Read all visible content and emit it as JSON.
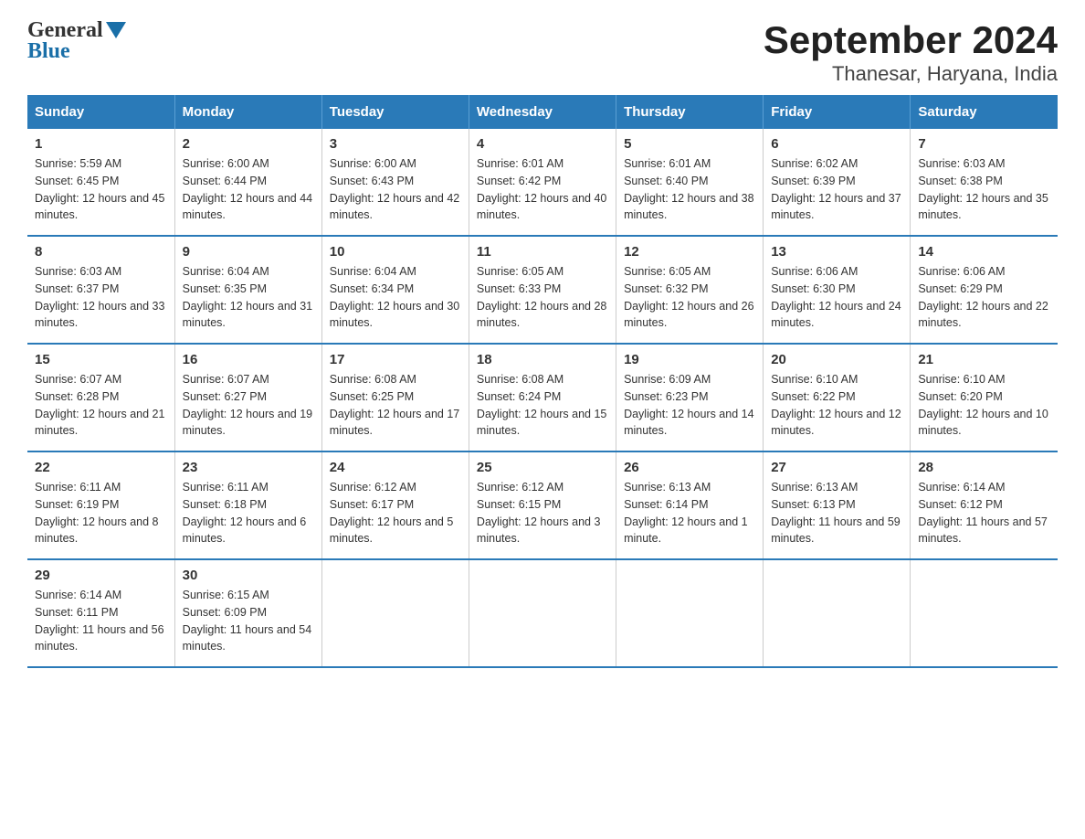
{
  "header": {
    "title": "September 2024",
    "subtitle": "Thanesar, Haryana, India",
    "logo_general": "General",
    "logo_blue": "Blue"
  },
  "columns": [
    "Sunday",
    "Monday",
    "Tuesday",
    "Wednesday",
    "Thursday",
    "Friday",
    "Saturday"
  ],
  "weeks": [
    [
      {
        "num": "1",
        "sunrise": "5:59 AM",
        "sunset": "6:45 PM",
        "daylight": "12 hours and 45 minutes."
      },
      {
        "num": "2",
        "sunrise": "6:00 AM",
        "sunset": "6:44 PM",
        "daylight": "12 hours and 44 minutes."
      },
      {
        "num": "3",
        "sunrise": "6:00 AM",
        "sunset": "6:43 PM",
        "daylight": "12 hours and 42 minutes."
      },
      {
        "num": "4",
        "sunrise": "6:01 AM",
        "sunset": "6:42 PM",
        "daylight": "12 hours and 40 minutes."
      },
      {
        "num": "5",
        "sunrise": "6:01 AM",
        "sunset": "6:40 PM",
        "daylight": "12 hours and 38 minutes."
      },
      {
        "num": "6",
        "sunrise": "6:02 AM",
        "sunset": "6:39 PM",
        "daylight": "12 hours and 37 minutes."
      },
      {
        "num": "7",
        "sunrise": "6:03 AM",
        "sunset": "6:38 PM",
        "daylight": "12 hours and 35 minutes."
      }
    ],
    [
      {
        "num": "8",
        "sunrise": "6:03 AM",
        "sunset": "6:37 PM",
        "daylight": "12 hours and 33 minutes."
      },
      {
        "num": "9",
        "sunrise": "6:04 AM",
        "sunset": "6:35 PM",
        "daylight": "12 hours and 31 minutes."
      },
      {
        "num": "10",
        "sunrise": "6:04 AM",
        "sunset": "6:34 PM",
        "daylight": "12 hours and 30 minutes."
      },
      {
        "num": "11",
        "sunrise": "6:05 AM",
        "sunset": "6:33 PM",
        "daylight": "12 hours and 28 minutes."
      },
      {
        "num": "12",
        "sunrise": "6:05 AM",
        "sunset": "6:32 PM",
        "daylight": "12 hours and 26 minutes."
      },
      {
        "num": "13",
        "sunrise": "6:06 AM",
        "sunset": "6:30 PM",
        "daylight": "12 hours and 24 minutes."
      },
      {
        "num": "14",
        "sunrise": "6:06 AM",
        "sunset": "6:29 PM",
        "daylight": "12 hours and 22 minutes."
      }
    ],
    [
      {
        "num": "15",
        "sunrise": "6:07 AM",
        "sunset": "6:28 PM",
        "daylight": "12 hours and 21 minutes."
      },
      {
        "num": "16",
        "sunrise": "6:07 AM",
        "sunset": "6:27 PM",
        "daylight": "12 hours and 19 minutes."
      },
      {
        "num": "17",
        "sunrise": "6:08 AM",
        "sunset": "6:25 PM",
        "daylight": "12 hours and 17 minutes."
      },
      {
        "num": "18",
        "sunrise": "6:08 AM",
        "sunset": "6:24 PM",
        "daylight": "12 hours and 15 minutes."
      },
      {
        "num": "19",
        "sunrise": "6:09 AM",
        "sunset": "6:23 PM",
        "daylight": "12 hours and 14 minutes."
      },
      {
        "num": "20",
        "sunrise": "6:10 AM",
        "sunset": "6:22 PM",
        "daylight": "12 hours and 12 minutes."
      },
      {
        "num": "21",
        "sunrise": "6:10 AM",
        "sunset": "6:20 PM",
        "daylight": "12 hours and 10 minutes."
      }
    ],
    [
      {
        "num": "22",
        "sunrise": "6:11 AM",
        "sunset": "6:19 PM",
        "daylight": "12 hours and 8 minutes."
      },
      {
        "num": "23",
        "sunrise": "6:11 AM",
        "sunset": "6:18 PM",
        "daylight": "12 hours and 6 minutes."
      },
      {
        "num": "24",
        "sunrise": "6:12 AM",
        "sunset": "6:17 PM",
        "daylight": "12 hours and 5 minutes."
      },
      {
        "num": "25",
        "sunrise": "6:12 AM",
        "sunset": "6:15 PM",
        "daylight": "12 hours and 3 minutes."
      },
      {
        "num": "26",
        "sunrise": "6:13 AM",
        "sunset": "6:14 PM",
        "daylight": "12 hours and 1 minute."
      },
      {
        "num": "27",
        "sunrise": "6:13 AM",
        "sunset": "6:13 PM",
        "daylight": "11 hours and 59 minutes."
      },
      {
        "num": "28",
        "sunrise": "6:14 AM",
        "sunset": "6:12 PM",
        "daylight": "11 hours and 57 minutes."
      }
    ],
    [
      {
        "num": "29",
        "sunrise": "6:14 AM",
        "sunset": "6:11 PM",
        "daylight": "11 hours and 56 minutes."
      },
      {
        "num": "30",
        "sunrise": "6:15 AM",
        "sunset": "6:09 PM",
        "daylight": "11 hours and 54 minutes."
      },
      null,
      null,
      null,
      null,
      null
    ]
  ],
  "labels": {
    "sunrise_prefix": "Sunrise: ",
    "sunset_prefix": "Sunset: ",
    "daylight_prefix": "Daylight: "
  }
}
